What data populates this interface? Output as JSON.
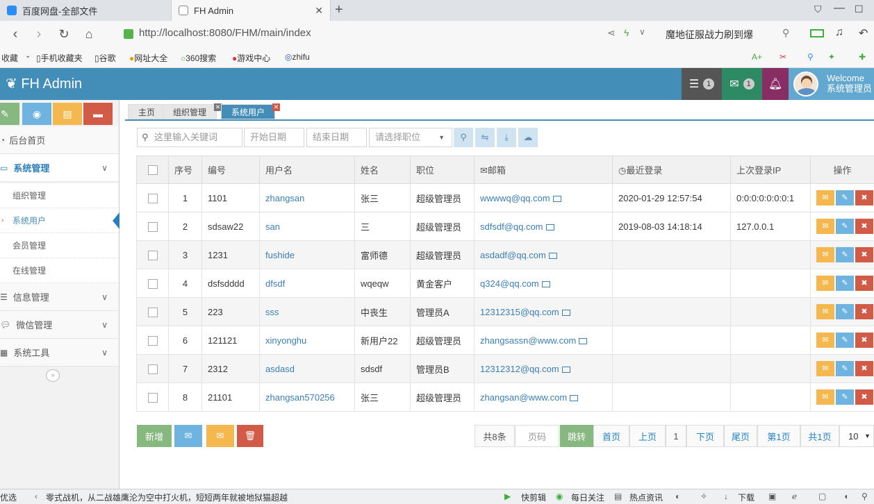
{
  "browser": {
    "tabs": [
      {
        "title": "百度网盘-全部文件"
      },
      {
        "title": "FH Admin"
      }
    ],
    "url": "http://localhost:8080/FHM/main/index",
    "search_text": "魔地征服战力刷到爆",
    "bookmarks": [
      "收藏",
      "手机收藏夹",
      "谷歌",
      "网址大全",
      "360搜索",
      "游戏中心",
      "zhifu"
    ]
  },
  "header": {
    "brand": "FH Admin",
    "tasks_badge": "1",
    "messages_badge": "1",
    "welcome_line1": "Welcome",
    "welcome_line2": "系统管理员"
  },
  "sidebar": {
    "items": [
      {
        "label": "后台首页"
      },
      {
        "label": "系统管理"
      },
      {
        "label": "组织管理"
      },
      {
        "label": "系统用户"
      },
      {
        "label": "会员管理"
      },
      {
        "label": "在线管理"
      },
      {
        "label": "信息管理"
      },
      {
        "label": "微信管理"
      },
      {
        "label": "系统工具"
      }
    ]
  },
  "page_tabs": [
    "主页",
    "组织管理",
    "系统用户"
  ],
  "filters": {
    "keyword_placeholder": "这里输入关键词",
    "start_date_placeholder": "开始日期",
    "end_date_placeholder": "结束日期",
    "role_placeholder": "请选择职位"
  },
  "table": {
    "headers": [
      "序号",
      "编号",
      "用户名",
      "姓名",
      "职位",
      "邮箱",
      "最近登录",
      "上次登录IP",
      "操作"
    ],
    "rows": [
      {
        "no": "1",
        "id": "1101",
        "username": "zhangsan",
        "name": "张三",
        "role": "超级管理员",
        "email": "wwwwq@qq.com",
        "last_login": "2020-01-29 12:57:54",
        "ip": "0:0:0:0:0:0:0:1"
      },
      {
        "no": "2",
        "id": "sdsaw22",
        "username": "san",
        "name": "三",
        "role": "超级管理员",
        "email": "sdfsdf@qq.com",
        "last_login": "2019-08-03 14:18:14",
        "ip": "127.0.0.1"
      },
      {
        "no": "3",
        "id": "1231",
        "username": "fushide",
        "name": "富师德",
        "role": "超级管理员",
        "email": "asdadf@qq.com",
        "last_login": "",
        "ip": ""
      },
      {
        "no": "4",
        "id": "dsfsdddd",
        "username": "dfsdf",
        "name": "wqeqw",
        "role": "黄金客户",
        "email": "q324@qq.com",
        "last_login": "",
        "ip": ""
      },
      {
        "no": "5",
        "id": "223",
        "username": "sss",
        "name": "中丧生",
        "role": "管理员A",
        "email": "12312315@qq.com",
        "last_login": "",
        "ip": ""
      },
      {
        "no": "6",
        "id": "121121",
        "username": "xinyonghu",
        "name": "新用户22",
        "role": "超级管理员",
        "email": "zhangsassn@www.com",
        "last_login": "",
        "ip": ""
      },
      {
        "no": "7",
        "id": "2312",
        "username": "asdasd",
        "name": "sdsdf",
        "role": "管理员B",
        "email": "12312312@qq.com",
        "last_login": "",
        "ip": ""
      },
      {
        "no": "8",
        "id": "21101",
        "username": "zhangsan570256",
        "name": "张三",
        "role": "超级管理员",
        "email": "zhangsan@www.com",
        "last_login": "",
        "ip": ""
      }
    ]
  },
  "actions": {
    "add_label": "新增"
  },
  "pagination": {
    "total": "共8条",
    "page_input_placeholder": "页码",
    "jump": "跳转",
    "first": "首页",
    "prev": "上页",
    "current": "1",
    "next": "下页",
    "last": "尾页",
    "page_of": "第1页",
    "total_pages": "共1页",
    "page_size": "10"
  },
  "statusbar": {
    "left_prefix": "优选",
    "news": "零式战机，从二战雄鹰沦为空中打火机，短短两年就被地狱猫超越",
    "items": [
      "快剪辑",
      "每日关注",
      "热点资讯",
      "下载"
    ]
  },
  "colors": {
    "header_blue": "#438eb9",
    "accent_green": "#87b87f",
    "accent_yellow": "#f4b84e",
    "accent_red": "#d15b47",
    "accent_lightblue": "#6fb3e0"
  }
}
